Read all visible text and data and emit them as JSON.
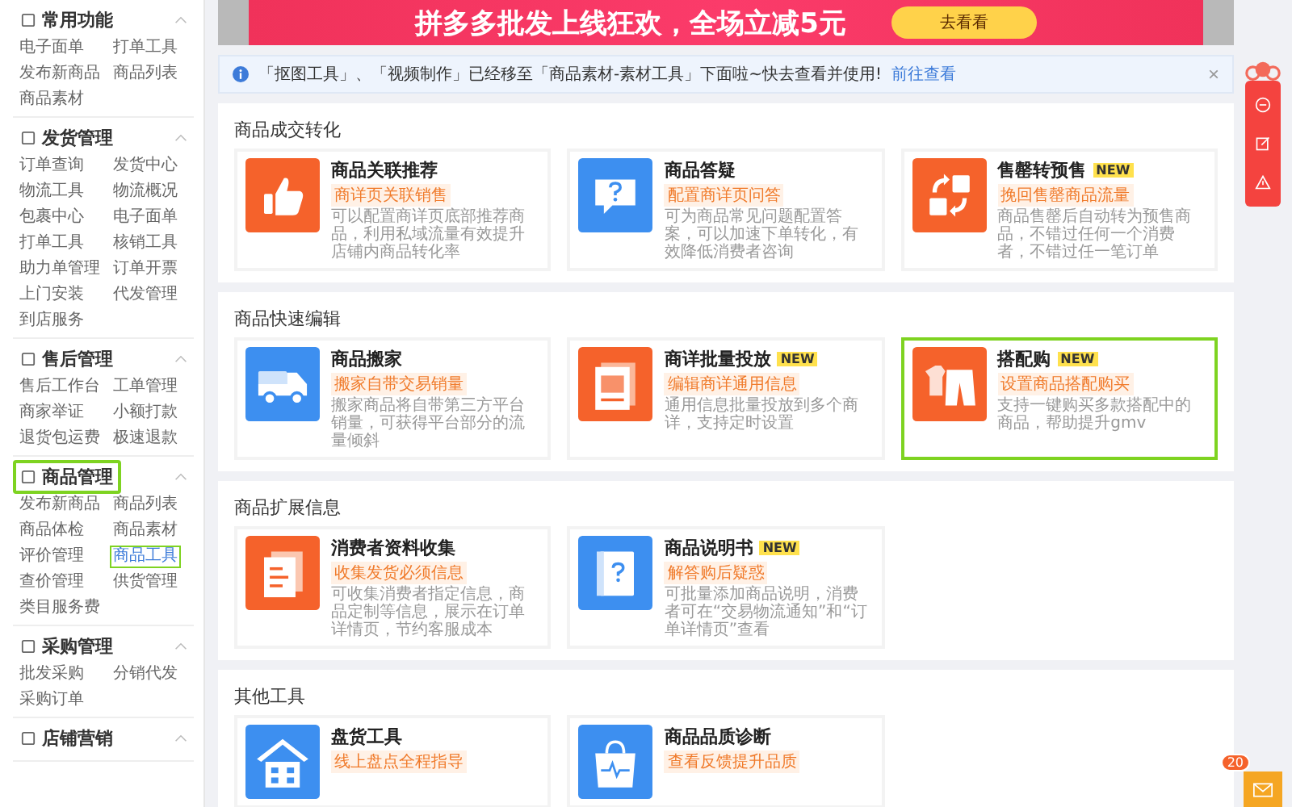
{
  "sidebar": {
    "groups": [
      {
        "title": "常用功能",
        "highlighted": false,
        "items": [
          {
            "label": "电子面单",
            "selected": false
          },
          {
            "label": "打单工具",
            "selected": false
          },
          {
            "label": "发布新商品",
            "selected": false
          },
          {
            "label": "商品列表",
            "selected": false
          },
          {
            "label": "商品素材",
            "selected": false
          }
        ]
      },
      {
        "title": "发货管理",
        "highlighted": false,
        "items": [
          {
            "label": "订单查询",
            "selected": false
          },
          {
            "label": "发货中心",
            "selected": false
          },
          {
            "label": "物流工具",
            "selected": false
          },
          {
            "label": "物流概况",
            "selected": false
          },
          {
            "label": "包裹中心",
            "selected": false
          },
          {
            "label": "电子面单",
            "selected": false
          },
          {
            "label": "打单工具",
            "selected": false
          },
          {
            "label": "核销工具",
            "selected": false
          },
          {
            "label": "助力单管理",
            "selected": false
          },
          {
            "label": "订单开票",
            "selected": false
          },
          {
            "label": "上门安装",
            "selected": false
          },
          {
            "label": "代发管理",
            "selected": false
          },
          {
            "label": "到店服务",
            "selected": false
          }
        ]
      },
      {
        "title": "售后管理",
        "highlighted": false,
        "items": [
          {
            "label": "售后工作台",
            "selected": false
          },
          {
            "label": "工单管理",
            "selected": false
          },
          {
            "label": "商家举证",
            "selected": false
          },
          {
            "label": "小额打款",
            "selected": false
          },
          {
            "label": "退货包运费",
            "selected": false
          },
          {
            "label": "极速退款",
            "selected": false
          }
        ]
      },
      {
        "title": "商品管理",
        "highlighted": true,
        "items": [
          {
            "label": "发布新商品",
            "selected": false
          },
          {
            "label": "商品列表",
            "selected": false
          },
          {
            "label": "商品体检",
            "selected": false
          },
          {
            "label": "商品素材",
            "selected": false
          },
          {
            "label": "评价管理",
            "selected": false
          },
          {
            "label": "商品工具",
            "selected": true
          },
          {
            "label": "查价管理",
            "selected": false
          },
          {
            "label": "供货管理",
            "selected": false
          },
          {
            "label": "类目服务费",
            "selected": false
          }
        ]
      },
      {
        "title": "采购管理",
        "highlighted": false,
        "items": [
          {
            "label": "批发采购",
            "selected": false
          },
          {
            "label": "分销代发",
            "selected": false
          },
          {
            "label": "采购订单",
            "selected": false
          }
        ]
      },
      {
        "title": "店铺营销",
        "highlighted": false
      }
    ]
  },
  "banner": {
    "text": "拼多多批发上线狂欢，全场立减5元",
    "button": "去看看"
  },
  "notice": {
    "text": "「抠图工具」、「视频制作」已经移至「商品素材-素材工具」下面啦~快去查看并使用!",
    "link": "前往查看",
    "close": "×"
  },
  "sections": [
    {
      "title": "商品成交转化",
      "cards": [
        {
          "title": "商品关联推荐",
          "highlighted": false,
          "kind": "thumb",
          "color": "#f5622b",
          "tag": "商详页关联销售",
          "description": "可以配置商详页底部推荐商品，利用私域流量有效提升店铺内商品转化率"
        },
        {
          "title": "商品答疑",
          "highlighted": false,
          "kind": "question",
          "color": "#3d8ff0",
          "tag": "配置商详页问答",
          "description": "可为商品常见问题配置答案，可以加速下单转化，有效降低消费者咨询"
        },
        {
          "title": "售罄转预售",
          "badge": "NEW",
          "highlighted": false,
          "kind": "swap",
          "color": "#f5622b",
          "tag": "挽回售罄商品流量",
          "description": "商品售罄后自动转为预售商品，不错过任何一个消费者，不错过任一笔订单"
        }
      ]
    },
    {
      "title": "商品快速编辑",
      "cards": [
        {
          "title": "商品搬家",
          "highlighted": false,
          "kind": "truck",
          "color": "#3d8ff0",
          "tag": "搬家自带交易销量",
          "description": "搬家商品将自带第三方平台销量，可获得平台部分的流量倾斜"
        },
        {
          "title": "商详批量投放",
          "badge": "NEW",
          "highlighted": false,
          "kind": "pages",
          "color": "#f5622b",
          "tag": "编辑商详通用信息",
          "description": "通用信息批量投放到多个商详，支持定时设置"
        },
        {
          "title": "搭配购",
          "badge": "NEW",
          "highlighted": true,
          "kind": "clothes",
          "color": "#f5622b",
          "tag": "设置商品搭配购买",
          "description": "支持一键购买多款搭配中的商品，帮助提升gmv"
        }
      ]
    },
    {
      "title": "商品扩展信息",
      "cards": [
        {
          "title": "消费者资料收集",
          "highlighted": false,
          "kind": "doc",
          "color": "#f5622b",
          "tag": "收集发货必须信息",
          "description": "可收集消费者指定信息，商品定制等信息，展示在订单详情页，节约客服成本"
        },
        {
          "title": "商品说明书",
          "badge": "NEW",
          "highlighted": false,
          "kind": "book",
          "color": "#3d8ff0",
          "tag": "解答购后疑惑",
          "description": "可批量添加商品说明，消费者可在“交易物流通知”和“订单详情页”查看"
        }
      ]
    },
    {
      "title": "其他工具",
      "cards": [
        {
          "title": "盘货工具",
          "highlighted": false,
          "kind": "store",
          "color": "#3d8ff0",
          "tag": "线上盘点全程指导"
        },
        {
          "title": "商品品质诊断",
          "highlighted": false,
          "kind": "bag",
          "color": "#3d8ff0",
          "tag": "查看反馈提升品质"
        }
      ]
    }
  ],
  "mail": {
    "badge": "20"
  }
}
